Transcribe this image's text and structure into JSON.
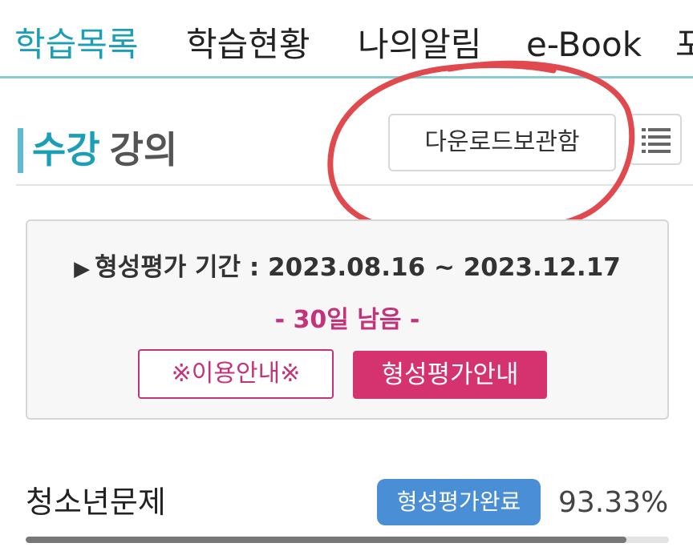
{
  "nav": {
    "tabs": [
      {
        "label": "학습목록",
        "active": true
      },
      {
        "label": "학습현황",
        "active": false
      },
      {
        "label": "나의알림",
        "active": false
      },
      {
        "label": "e-Book",
        "active": false
      },
      {
        "label": "포",
        "active": false
      }
    ]
  },
  "section": {
    "title_highlight": "수강",
    "title_rest": "강의",
    "download_label": "다운로드보관함",
    "list_icon": "list-icon"
  },
  "info": {
    "period_arrow": "▶",
    "period_text": "형성평가 기간 : 2023.08.16 ~ 2023.12.17",
    "remaining": "- 30일 남음 -",
    "guide_label": "※이용안내※",
    "eval_label": "형성평가안내"
  },
  "course": {
    "title": "청소년문제",
    "status": "형성평가완료",
    "progress_text": "93.33%",
    "progress_value": 93.33
  },
  "colors": {
    "accent": "#1b9fb6",
    "magenta": "#d4336f",
    "badge_blue": "#4a8fd6",
    "annotation_red": "#e04a4f"
  }
}
